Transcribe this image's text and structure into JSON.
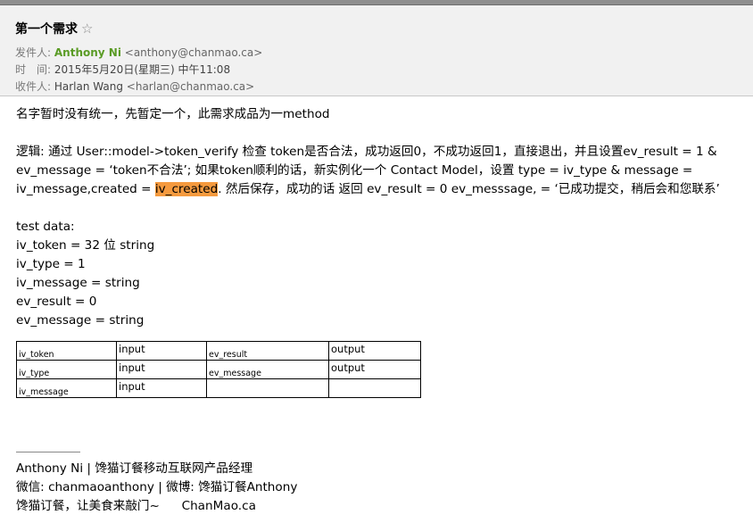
{
  "subject": "第一个需求",
  "star_icon": "☆",
  "from": {
    "label": "发件人:",
    "name": "Anthony Ni",
    "address": "<anthony@chanmao.ca>"
  },
  "time": {
    "label": "时　间:",
    "value": "2015年5月20日(星期三) 中午11:08"
  },
  "to": {
    "label": "收件人:",
    "name": "Harlan Wang",
    "address": "<harlan@chanmao.ca>"
  },
  "body": {
    "line1": "名字暂时没有统一，先暂定一个，此需求成品为一method",
    "logic_line1": "逻辑: 通过 User::model->token_verify 检查 token是否合法，成功返回0，不成功返回1，直接退出，并且设置ev_result = 1 &",
    "logic_line2": "ev_message = ‘token不合法’; 如果token顺利的话，新实例化一个 Contact Model，设置 type = iv_type & message =",
    "logic_line3_pre": "iv_message,created = ",
    "logic_line3_highlight": "iv_created",
    "logic_line3_post": ". 然后保存，成功的话 返回 ev_result = 0 ev_messsage, = ‘已成功提交，稍后会和您联系’",
    "test_data_title": "test data:",
    "test_lines": [
      "iv_token = 32 位 string",
      "iv_type = 1",
      "iv_message = string",
      "ev_result = 0",
      "ev_message = string"
    ]
  },
  "table": {
    "rows": [
      [
        "iv_token",
        "input",
        "ev_result",
        "output"
      ],
      [
        "iv_type",
        "input",
        "ev_message",
        "output"
      ],
      [
        "iv_message",
        "input",
        "",
        ""
      ]
    ]
  },
  "signature": {
    "line1": "Anthony Ni  | 馋猫订餐移动互联网产品经理",
    "line2": "微信: chanmaoanthony | 微博: 馋猫订餐Anthony",
    "line3_text": "馋猫订餐，让美食来敲门~",
    "line3_link": "ChanMao.ca"
  }
}
